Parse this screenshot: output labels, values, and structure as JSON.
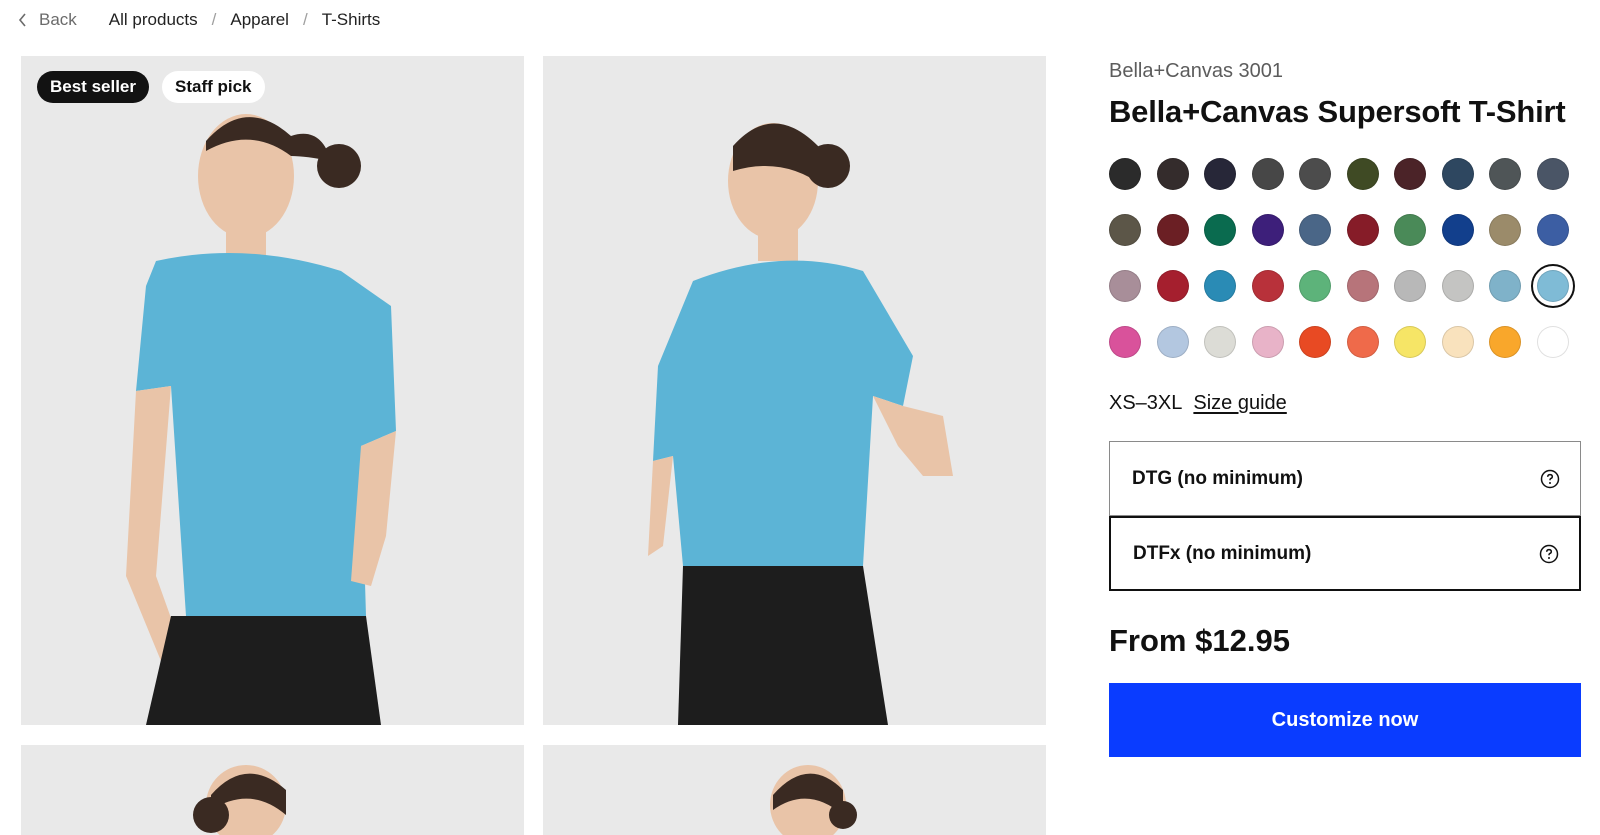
{
  "breadcrumb": {
    "back_label": "Back",
    "items": [
      "All products",
      "Apparel",
      "T-Shirts"
    ]
  },
  "gallery": {
    "badges": [
      "Best seller",
      "Staff pick"
    ],
    "shirt_color": "#5cb4d6"
  },
  "product": {
    "brand": "Bella+Canvas 3001",
    "title": "Bella+Canvas Supersoft T-Shirt",
    "colors": [
      "#2b2b2b",
      "#342c2c",
      "#272738",
      "#474747",
      "#4c4c4c",
      "#3f4a24",
      "#4b2328",
      "#2e4760",
      "#4f5557",
      "#4a5566",
      "#5c5648",
      "#6b1f24",
      "#0a6b4f",
      "#3d1f7a",
      "#4a6687",
      "#861c28",
      "#4a8a58",
      "#123f8c",
      "#9b8b6a",
      "#3c5ea3",
      "#a88e99",
      "#a51f2e",
      "#2a8bb5",
      "#b8313a",
      "#5db37a",
      "#b7747a",
      "#b8b8b8",
      "#c4c4c2",
      "#7fb2c9",
      "#7fbbd6",
      "#d9529b",
      "#b3c7e0",
      "#dcdcd6",
      "#e8b3c8",
      "#e84a23",
      "#ef6a4a",
      "#f6e566",
      "#f9e2bd",
      "#f9a72b",
      "#ffffff"
    ],
    "selected_color_index": 29,
    "size_range": "XS–3XL",
    "size_guide_label": "Size guide",
    "print_options": [
      {
        "label": "DTG (no minimum)",
        "selected": false
      },
      {
        "label": "DTFx (no minimum)",
        "selected": true
      }
    ],
    "price": "From $12.95",
    "cta_label": "Customize now",
    "accent_color": "#0a3cff"
  }
}
